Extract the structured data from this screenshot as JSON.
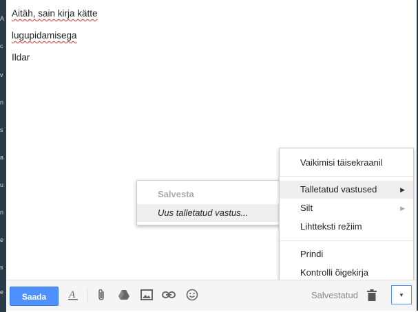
{
  "message": {
    "lines": [
      "Aitäh, sain kirja kätte",
      "lugupidamisega",
      "Ildar"
    ]
  },
  "toolbar": {
    "send_label": "Saada",
    "saved_label": "Salvestatud",
    "icons": [
      "format-text-icon",
      "attach-icon",
      "drive-icon",
      "photo-icon",
      "link-icon",
      "emoji-icon",
      "trash-icon",
      "more-options-icon"
    ]
  },
  "more_menu": {
    "items": {
      "fullscreen": "Vaikimisi täisekraanil",
      "canned": "Talletatud vastused",
      "label": "Silt",
      "plaintext": "Lihtteksti režiim",
      "print": "Prindi",
      "spellcheck": "Kontrolli õigekirja"
    }
  },
  "canned_menu": {
    "save_header": "Salvesta",
    "new_item": "Uus talletatud vastus..."
  },
  "colors": {
    "send_button": "#4d90fe",
    "menu_hover": "#eeeeee",
    "sidebar": "#2b3a45"
  }
}
